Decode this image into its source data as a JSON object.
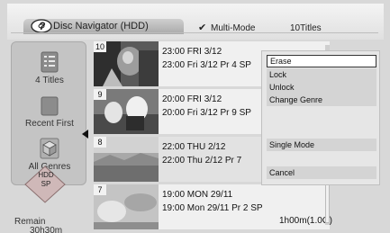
{
  "header": {
    "title": "Disc Navigator (HDD)",
    "mode": "Multi-Mode",
    "count": "10Titles"
  },
  "sidebar": {
    "items": [
      {
        "label": "4 Titles",
        "icon": "title-list-icon"
      },
      {
        "label": "Recent First",
        "icon": "sort-order-icon"
      },
      {
        "label": "All Genres",
        "icon": "genre-cube-icon"
      }
    ],
    "drive": {
      "line1": "HDD",
      "line2": "SP"
    },
    "remain_label": "Remain",
    "remain_value": "30h30m"
  },
  "titles": [
    {
      "number": "10",
      "line1": "23:00 FRI 3/12",
      "line2": "23:00 Fri 3/12 Pr 4 SP",
      "duration": ""
    },
    {
      "number": "9",
      "line1": "20:00 FRI 3/12",
      "line2": "20:00 Fri 3/12 Pr 9 SP",
      "duration": ""
    },
    {
      "number": "8",
      "line1": "22:00 THU 2/12",
      "line2": "22:00 Thu 2/12 Pr 7",
      "duration": ""
    },
    {
      "number": "7",
      "line1": "19:00 MON 29/11",
      "line2": "19:00 Mon 29/11 Pr 2 SP",
      "duration": "1h00m(1.0G)"
    }
  ],
  "menu": {
    "items": [
      "Erase",
      "Lock",
      "Unlock",
      "Change Genre"
    ],
    "selected": "Erase",
    "single_mode": "Single Mode",
    "cancel": "Cancel"
  },
  "colors": {
    "background": "#d8d8d8",
    "panel": "#c4c4c4",
    "row": "#f0f0f0",
    "selection_border": "#333333"
  }
}
